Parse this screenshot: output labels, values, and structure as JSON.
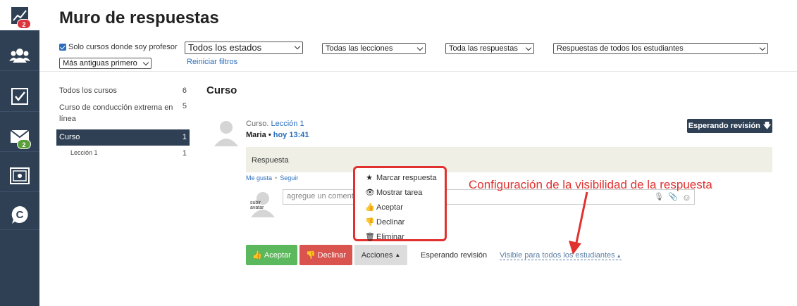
{
  "page": {
    "title": "Muro de respuestas"
  },
  "rail": {
    "items": [
      {
        "icon": "chart-icon",
        "badge": "2",
        "badge_color": "#d9363e"
      },
      {
        "icon": "users-icon"
      },
      {
        "icon": "checkbox-icon"
      },
      {
        "icon": "mail-icon",
        "badge": "2",
        "badge_color": "#5a9e3a"
      },
      {
        "icon": "safe-icon"
      },
      {
        "icon": "chat-c-icon"
      }
    ]
  },
  "filters": {
    "only_my_courses": "Solo cursos donde soy profesor",
    "status": "Todos los estados",
    "lessons": "Todas las lecciones",
    "answers": "Toda las respuestas",
    "students": "Respuestas de todos los estudiantes",
    "order": "Más antiguas primero",
    "reset": "Reiniciar filtros"
  },
  "courses": [
    {
      "label": "Todos los cursos",
      "count": "6"
    },
    {
      "label": "Curso de conducción extrema en línea",
      "count": "5"
    },
    {
      "label": "Curso",
      "count": "1",
      "active": true
    },
    {
      "label": "Lección 1",
      "count": "1",
      "sub": true
    }
  ],
  "main": {
    "section_title": "Curso",
    "post": {
      "course": "Curso.",
      "lesson": "Lección 1",
      "author": "Maria",
      "separator": "•",
      "time": "hoy 13:41",
      "status_button": "Esperando revisión",
      "answer": "Respuesta",
      "like": "Me gusta",
      "follow": "Seguir",
      "upload_avatar": "subir avatar",
      "comment_placeholder": "agregue un comentario"
    },
    "actions": {
      "accept": "Aceptar",
      "decline": "Declinar",
      "actions": "Acciones",
      "waiting": "Esperando revisión",
      "visibility": "Visible para todos los estudiantes"
    },
    "menu": [
      {
        "icon": "star-icon",
        "label": "Marcar respuesta"
      },
      {
        "icon": "eye-icon",
        "label": "Mostrar tarea"
      },
      {
        "icon": "thumbs-up-icon",
        "label": "Aceptar"
      },
      {
        "icon": "thumbs-down-icon",
        "label": "Declinar"
      },
      {
        "icon": "trash-icon",
        "label": "Eliminar"
      }
    ]
  },
  "annotation": {
    "text": "Configuración de la visibilidad de la respuesta",
    "color": "#e0312f"
  }
}
